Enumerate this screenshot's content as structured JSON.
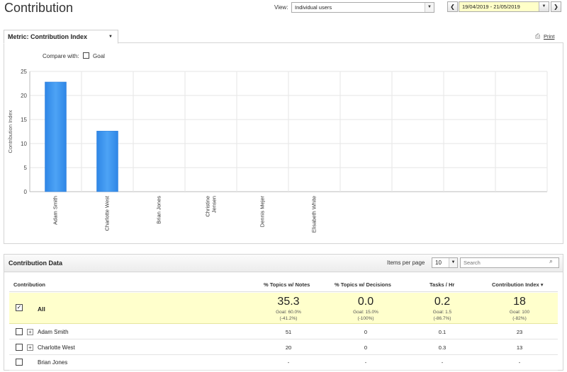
{
  "page": {
    "title": "Contribution"
  },
  "view": {
    "label": "View:",
    "selected": "Individual users"
  },
  "date_range": {
    "value": "19/04/2019 - 21/05/2019",
    "prev_label": "❮",
    "next_label": "❯"
  },
  "metric_tab": {
    "label": "Metric: Contribution Index"
  },
  "print": {
    "label": "Print"
  },
  "compare": {
    "label": "Compare with:",
    "option_label": "Goal",
    "checked": false
  },
  "chart_data": {
    "type": "bar",
    "ylabel": "Contribution Index",
    "ylim": [
      0,
      25
    ],
    "yticks": [
      0,
      5,
      10,
      15,
      20,
      25
    ],
    "categories": [
      "Adam Smith",
      "Charlotte West",
      "Brian Jones",
      "Christine\nJensen",
      "Dennis Mejer",
      "Elisabeth White",
      "",
      "",
      "",
      ""
    ],
    "values": [
      22.8,
      12.6,
      0,
      0,
      0,
      0,
      null,
      null,
      null,
      null
    ],
    "grid": true,
    "bar_color": "#4da3f5"
  },
  "data_panel": {
    "title": "Contribution Data",
    "items_per_page_label": "Items per page",
    "items_per_page_value": "10",
    "search_placeholder": "Search"
  },
  "table": {
    "headers": {
      "contribution": "Contribution",
      "topics_notes": "% Topics w/ Notes",
      "topics_decisions": "% Topics w/ Decisions",
      "tasks_hr": "Tasks / Hr",
      "contribution_index": "Contribution Index ▾"
    },
    "all_row": {
      "label": "All",
      "checked": true,
      "topics_notes": {
        "value": "35.3",
        "goal": "Goal: 60.0%",
        "diff": "(-41.2%)"
      },
      "topics_decisions": {
        "value": "0.0",
        "goal": "Goal: 15.0%",
        "diff": "(-100%)"
      },
      "tasks_hr": {
        "value": "0.2",
        "goal": "Goal: 1.5",
        "diff": "(-86.7%)"
      },
      "contribution_index": {
        "value": "18",
        "goal": "Goal: 100",
        "diff": "(-82%)"
      }
    },
    "rows": [
      {
        "name": "Adam Smith",
        "expandable": true,
        "topics_notes": "51",
        "topics_decisions": "0",
        "tasks_hr": "0.1",
        "contribution_index": "23"
      },
      {
        "name": "Charlotte West",
        "expandable": true,
        "topics_notes": "20",
        "topics_decisions": "0",
        "tasks_hr": "0.3",
        "contribution_index": "13"
      },
      {
        "name": "Brian Jones",
        "expandable": false,
        "topics_notes": "-",
        "topics_decisions": "-",
        "tasks_hr": "-",
        "contribution_index": "-"
      }
    ]
  }
}
